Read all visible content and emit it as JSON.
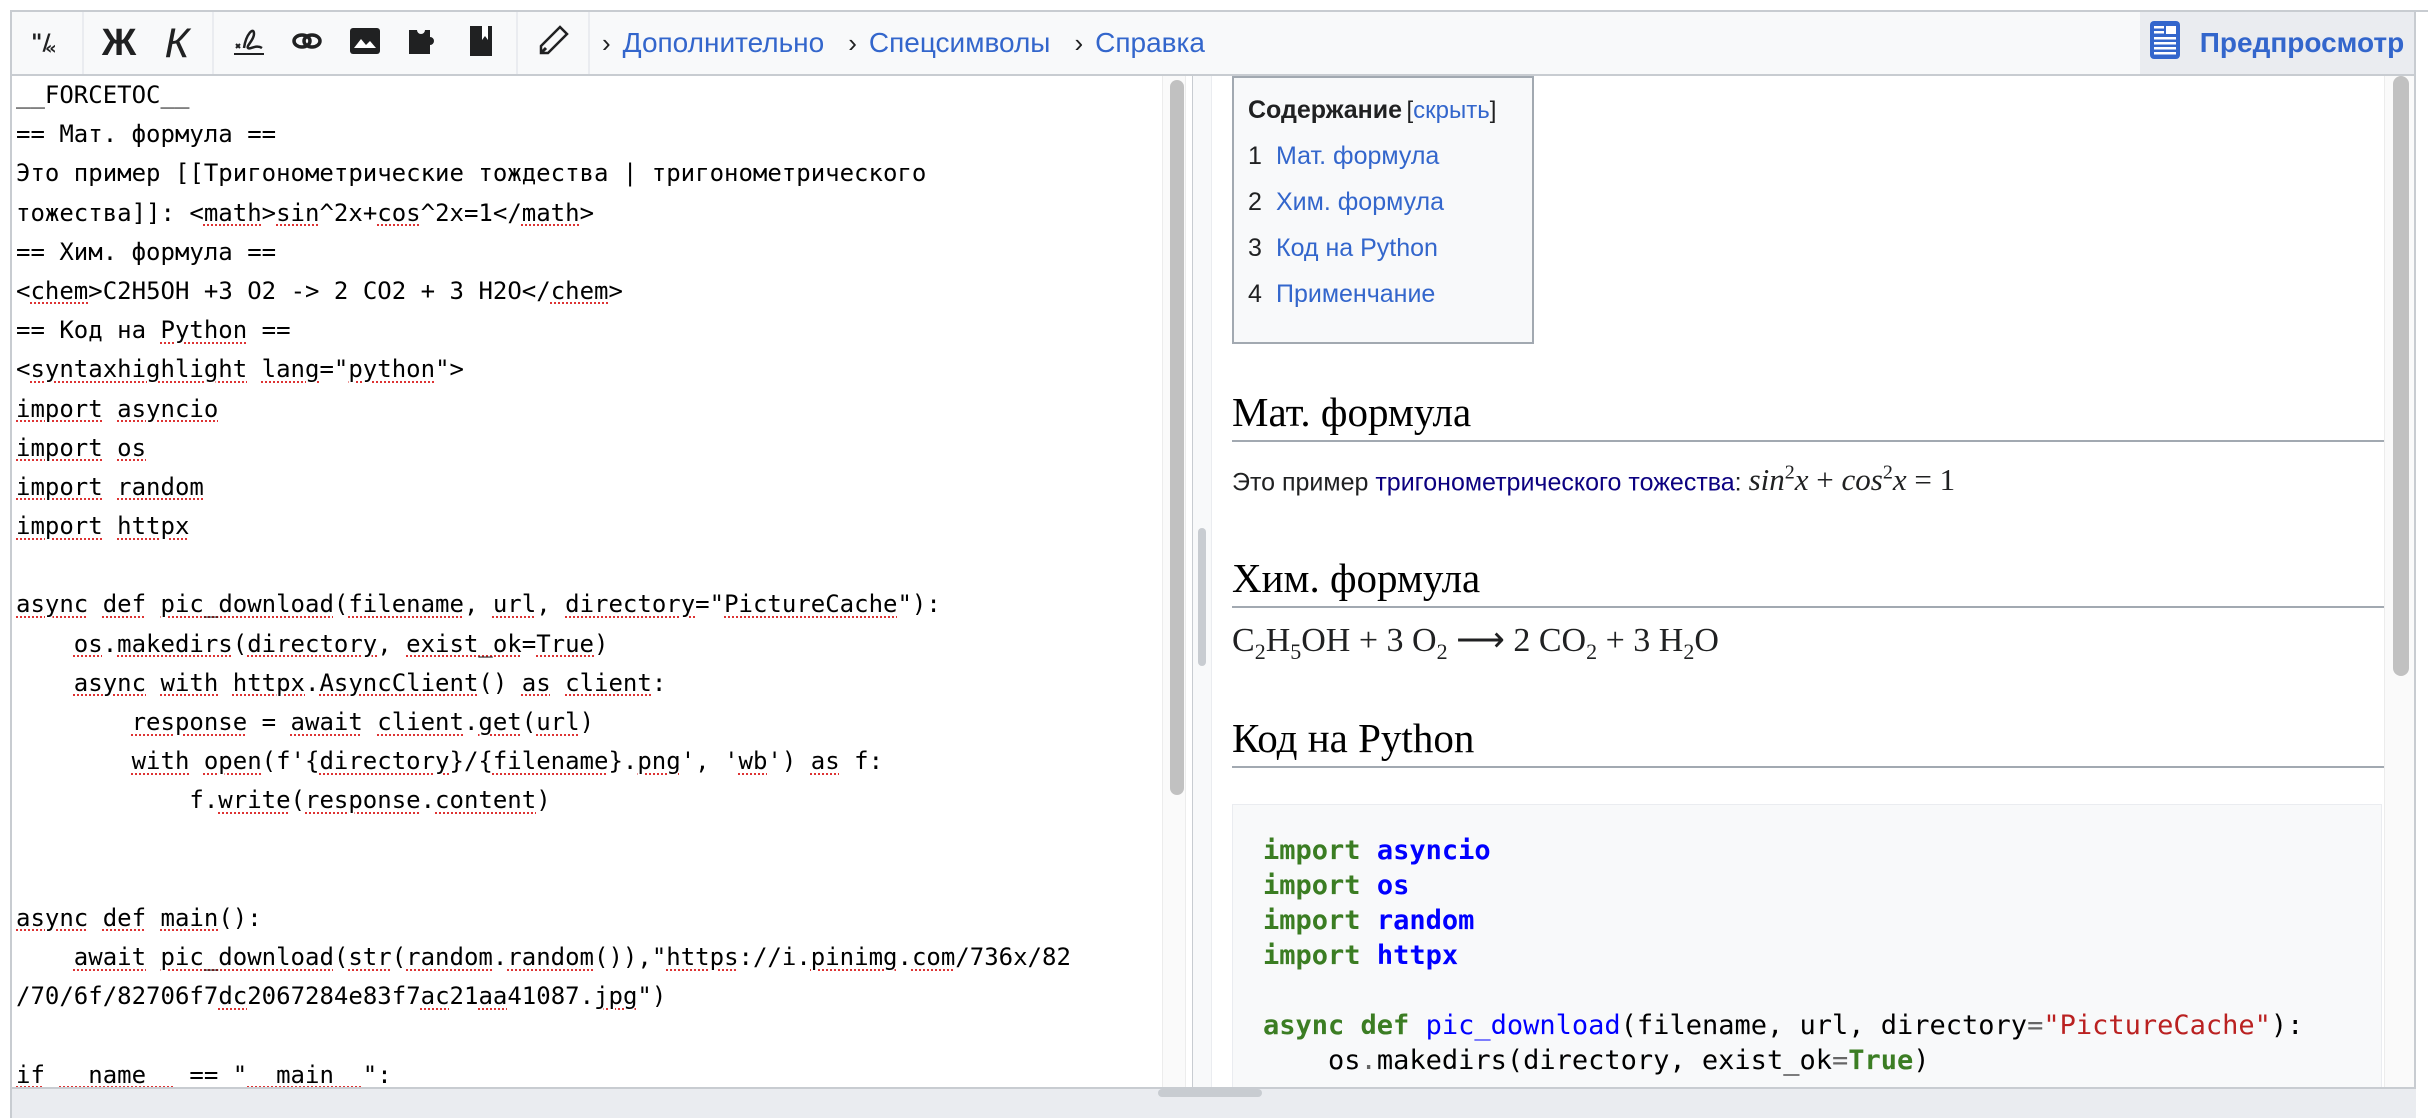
{
  "toolbar": {
    "icons": {
      "format": "format-quote-icon",
      "bold": "bold-icon",
      "italic": "italic-icon",
      "signature": "signature-icon",
      "link": "link-icon",
      "image": "image-icon",
      "template": "puzzle-icon",
      "reference": "bookmark-icon",
      "edit": "pencil-icon"
    },
    "bold_label": "Ж",
    "italic_label": "К",
    "menus": [
      {
        "chevron": "›",
        "label": "Дополнительно"
      },
      {
        "chevron": "›",
        "label": "Спецсимволы"
      },
      {
        "chevron": "›",
        "label": "Справка"
      }
    ],
    "preview_label": "Предпросмотр"
  },
  "editor": {
    "lines": [
      "__FORCETOC__",
      "== Мат. формула ==",
      "Это пример [[Тригонометрические тождества | тригонометрического",
      "тожества]]: <math>sin^2x+cos^2x=1</math>",
      "== Хим. формула ==",
      "<chem>C2H5OH +3 O2 -> 2 CO2 + 3 H2O</chem>",
      "== Код на Python ==",
      "<syntaxhighlight lang=\"python\">",
      "import asyncio",
      "import os",
      "import random",
      "import httpx",
      "",
      "async def pic_download(filename, url, directory=\"PictureCache\"):",
      "    os.makedirs(directory, exist_ok=True)",
      "    async with httpx.AsyncClient() as client:",
      "        response = await client.get(url)",
      "        with open(f'{directory}/{filename}.png', 'wb') as f:",
      "            f.write(response.content)",
      "",
      "",
      "async def main():",
      "    await pic_download(str(random.random()),\"https://i.pinimg.com/736x/82",
      "/70/6f/82706f7dc2067284e83f7ac21aa41087.jpg\")",
      "",
      "if __name__ == \"__main__\":"
    ]
  },
  "preview": {
    "toc": {
      "title": "Содержание",
      "toggle_open": "[",
      "toggle_label": "скрыть",
      "toggle_close": "]",
      "items": [
        {
          "num": "1",
          "label": "Мат. формула"
        },
        {
          "num": "2",
          "label": "Хим. формула"
        },
        {
          "num": "3",
          "label": "Код на Python"
        },
        {
          "num": "4",
          "label": "Применчание"
        }
      ]
    },
    "sections": {
      "math": {
        "heading": "Мат. формула",
        "text_before": "Это пример ",
        "link": "тригонометрического тожества",
        "text_after": ": ",
        "formula": {
          "a": "sin",
          "a_sup": "2",
          "x1": "x",
          "plus": " + ",
          "b": "cos",
          "b_sup": "2",
          "x2": "x",
          "eq": " = ",
          "rhs": "1"
        }
      },
      "chem": {
        "heading": "Хим. формула",
        "equation": {
          "c": "C",
          "c_sub": "2",
          "h": "H",
          "h_sub": "5",
          "oh": "OH",
          "plus1": " + 3 ",
          "o": "O",
          "o_sub": "2",
          "arrow": " ⟶ ",
          "co_coef": "2 ",
          "co": "CO",
          "co_sub": "2",
          "plus2": " + 3 ",
          "h2": "H",
          "h2_sub": "2",
          "h2o": "O"
        }
      },
      "python": {
        "heading": "Код на Python",
        "code": [
          [
            {
              "t": "import",
              "c": "kw"
            },
            {
              "t": " "
            },
            {
              "t": "asyncio",
              "c": "nm"
            }
          ],
          [
            {
              "t": "import",
              "c": "kw"
            },
            {
              "t": " "
            },
            {
              "t": "os",
              "c": "nm"
            }
          ],
          [
            {
              "t": "import",
              "c": "kw"
            },
            {
              "t": " "
            },
            {
              "t": "random",
              "c": "nm"
            }
          ],
          [
            {
              "t": "import",
              "c": "kw"
            },
            {
              "t": " "
            },
            {
              "t": "httpx",
              "c": "nm"
            }
          ],
          [
            {
              "t": ""
            }
          ],
          [
            {
              "t": "async",
              "c": "kw"
            },
            {
              "t": " "
            },
            {
              "t": "def",
              "c": "kw"
            },
            {
              "t": " "
            },
            {
              "t": "pic_download",
              "c": "fn"
            },
            {
              "t": "(filename, url, directory"
            },
            {
              "t": "=",
              "c": "op"
            },
            {
              "t": "\"PictureCache\"",
              "c": "str"
            },
            {
              "t": "):"
            }
          ],
          [
            {
              "t": "    os"
            },
            {
              "t": ".",
              "c": "op"
            },
            {
              "t": "makedirs(directory, exist_ok"
            },
            {
              "t": "=",
              "c": "op"
            },
            {
              "t": "True",
              "c": "kw"
            },
            {
              "t": ")"
            }
          ]
        ]
      }
    }
  }
}
